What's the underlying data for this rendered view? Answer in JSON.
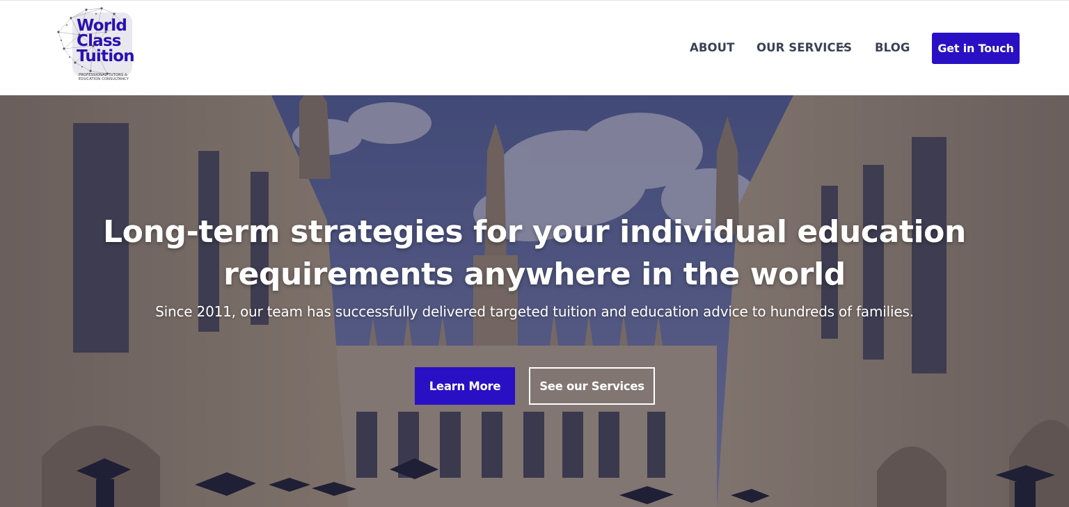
{
  "header": {
    "logo": {
      "lines": [
        "World",
        "Class",
        "Tuition"
      ],
      "tagline": "PROFESSIONAL TUTORS & EDUCATION CONSULTANCY"
    },
    "nav": {
      "about": "ABOUT",
      "services": "OUR SERVICES",
      "blog": "BLOG"
    },
    "cta_label": "Get in Touch"
  },
  "hero": {
    "title": "Long-term strategies for your individual education requirements anywhere in the world",
    "subtitle": "Since 2011, our team has successfully delivered targeted tuition and education advice to hundreds of families.",
    "primary_button": "Learn More",
    "secondary_button": "See our Services"
  },
  "colors": {
    "brand": "#2a10c4",
    "nav_text": "#3a4254",
    "hero_overlay": "#1e1c3e"
  },
  "icons": {
    "services_dropdown": "chevron-down-icon",
    "logo_graphic": "network-globe-icon"
  }
}
